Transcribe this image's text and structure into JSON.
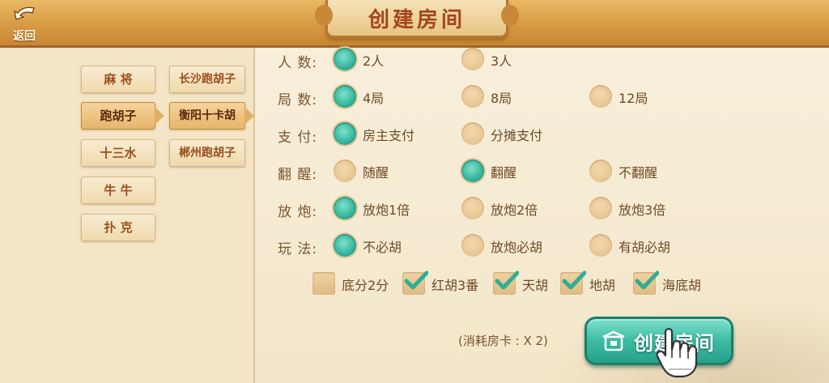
{
  "header": {
    "back_label": "返回",
    "title": "创建房间"
  },
  "categories": [
    {
      "label": "麻 将",
      "active": false
    },
    {
      "label": "跑胡子",
      "active": true
    },
    {
      "label": "十三水",
      "active": false
    },
    {
      "label": "牛 牛",
      "active": false
    },
    {
      "label": "扑 克",
      "active": false
    }
  ],
  "subcategories": [
    {
      "label": "长沙跑胡子",
      "active": false
    },
    {
      "label": "衡阳十卡胡",
      "active": true
    },
    {
      "label": "郴州跑胡子",
      "active": false
    }
  ],
  "settings": [
    {
      "label": "人 数:",
      "options": [
        {
          "text": "2人",
          "selected": true
        },
        {
          "text": "3人",
          "selected": false
        }
      ]
    },
    {
      "label": "局 数:",
      "options": [
        {
          "text": "4局",
          "selected": true
        },
        {
          "text": "8局",
          "selected": false
        },
        {
          "text": "12局",
          "selected": false
        }
      ]
    },
    {
      "label": "支 付:",
      "options": [
        {
          "text": "房主支付",
          "selected": true
        },
        {
          "text": "分摊支付",
          "selected": false
        }
      ]
    },
    {
      "label": "翻 醒:",
      "options": [
        {
          "text": "随醒",
          "selected": false
        },
        {
          "text": "翻醒",
          "selected": true
        },
        {
          "text": "不翻醒",
          "selected": false
        }
      ]
    },
    {
      "label": "放 炮:",
      "options": [
        {
          "text": "放炮1倍",
          "selected": true
        },
        {
          "text": "放炮2倍",
          "selected": false
        },
        {
          "text": "放炮3倍",
          "selected": false
        }
      ]
    },
    {
      "label": "玩 法:",
      "options": [
        {
          "text": "不必胡",
          "selected": true
        },
        {
          "text": "放炮必胡",
          "selected": false
        },
        {
          "text": "有胡必胡",
          "selected": false
        }
      ]
    }
  ],
  "extras": [
    {
      "text": "底分2分",
      "checked": false
    },
    {
      "text": "红胡3番",
      "checked": true
    },
    {
      "text": "天胡",
      "checked": true
    },
    {
      "text": "地胡",
      "checked": true
    },
    {
      "text": "海底胡",
      "checked": true
    }
  ],
  "footer": {
    "cost_text": "(消耗房卡 : X 2)",
    "create_label": "创建房间"
  },
  "colors": {
    "accent_teal": "#33b49b",
    "header_orange": "#d89a44",
    "title_red": "#a3451d"
  },
  "icons": [
    "back-arrow-icon",
    "room-icon",
    "pointer-hand-icon",
    "check-icon"
  ]
}
